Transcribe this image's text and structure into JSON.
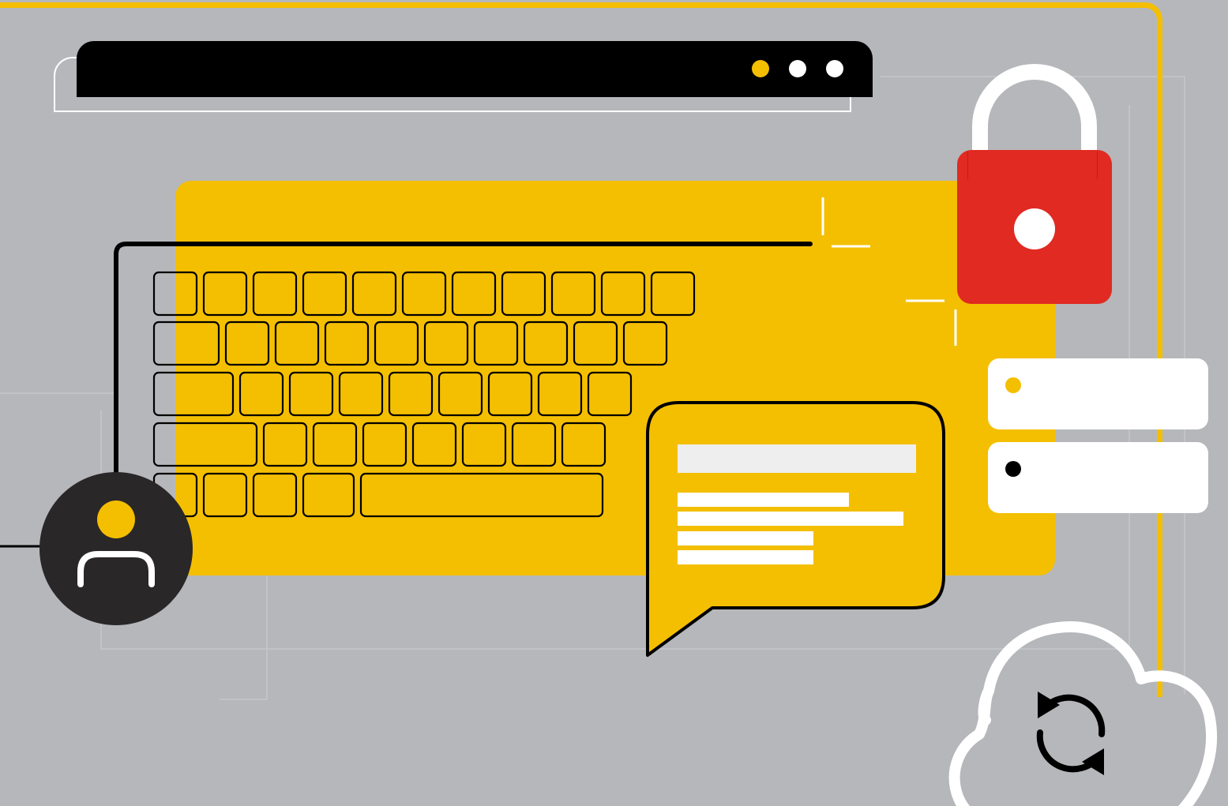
{
  "colors": {
    "background": "#b6b7bb",
    "accent_yellow": "#f4bf00",
    "lock_red": "#e02a22",
    "dark": "#2a2728",
    "black": "#000000",
    "white": "#ffffff",
    "bubble_placeholder": "#eeeeee"
  },
  "window": {
    "controls": [
      {
        "name": "yellow-control-dot",
        "color": "#f4bf00"
      },
      {
        "name": "white-control-dot",
        "color": "#ffffff"
      },
      {
        "name": "white-control-dot",
        "color": "#ffffff"
      }
    ]
  },
  "icons": {
    "lock": "padlock-icon",
    "user": "user-icon",
    "sync": "cloud-sync-icon",
    "message": "speech-bubble-icon",
    "keyboard": "keyboard-icon"
  },
  "keyboard": {
    "rows": [
      11,
      10,
      9,
      8,
      5
    ]
  },
  "settings_rows": [
    {
      "dot_color": "#f4bf00"
    },
    {
      "dot_color": "#000000"
    }
  ]
}
